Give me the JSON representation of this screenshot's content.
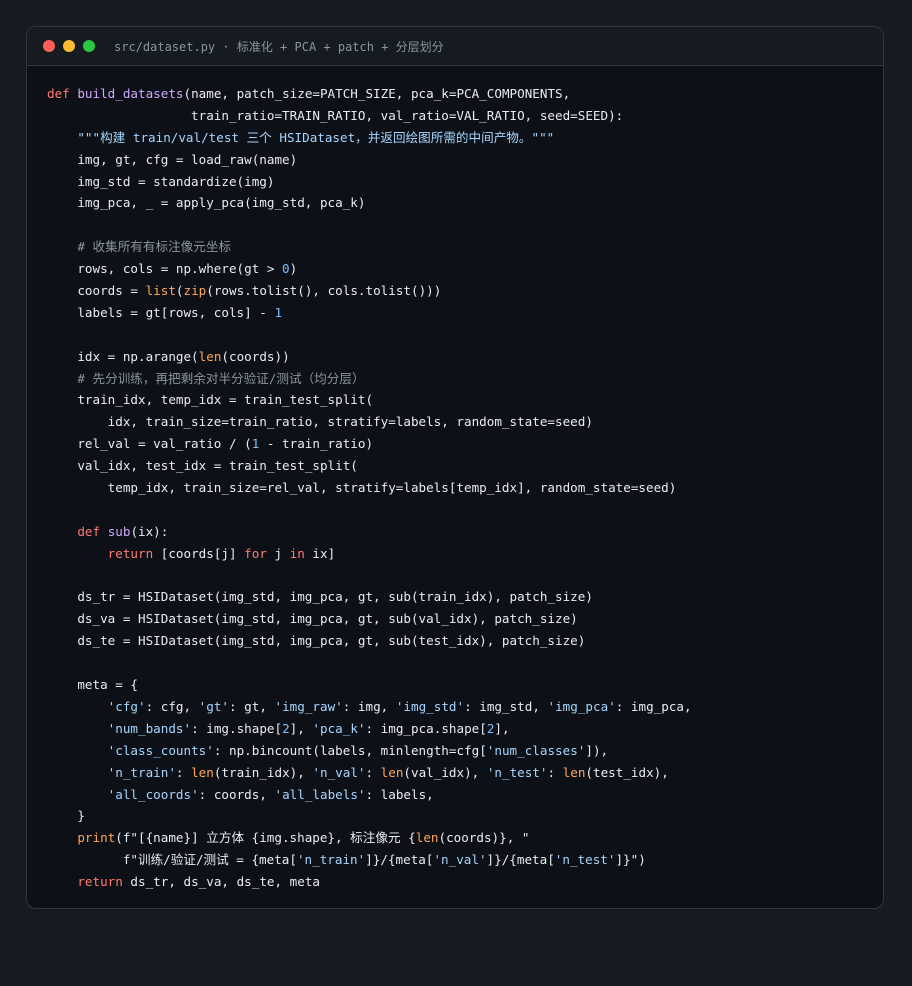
{
  "window": {
    "title": "src/dataset.py · 标准化 + PCA + patch + 分层划分"
  },
  "colors": {
    "keyword": "#ff7b72",
    "function": "#d2a8ff",
    "string": "#a5d6ff",
    "number": "#79c0ff",
    "comment": "#8b949e",
    "builtin": "#ffa657",
    "text": "#e6edf3"
  },
  "code": {
    "lines": [
      [
        [
          "kw",
          "def"
        ],
        [
          "tx",
          " "
        ],
        [
          "fn",
          "build_datasets"
        ],
        [
          "tx",
          "(name, patch_size=PATCH_SIZE, pca_k=PCA_COMPONENTS,"
        ]
      ],
      [
        [
          "tx",
          "                   train_ratio=TRAIN_RATIO, val_ratio=VAL_RATIO, seed=SEED):"
        ]
      ],
      [
        [
          "tx",
          "    "
        ],
        [
          "str",
          "\"\"\"构建 train/val/test 三个 HSIDataset，并返回绘图所需的中间产物。\"\"\""
        ]
      ],
      [
        [
          "tx",
          "    img, gt, cfg = load_raw(name)"
        ]
      ],
      [
        [
          "tx",
          "    img_std = standardize(img)"
        ]
      ],
      [
        [
          "tx",
          "    img_pca, _ = apply_pca(img_std, pca_k)"
        ]
      ],
      [
        [
          "tx",
          ""
        ]
      ],
      [
        [
          "tx",
          "    "
        ],
        [
          "cm",
          "# 收集所有有标注像元坐标"
        ]
      ],
      [
        [
          "tx",
          "    rows, cols = np.where(gt > "
        ],
        [
          "num",
          "0"
        ],
        [
          "tx",
          ")"
        ]
      ],
      [
        [
          "tx",
          "    coords = "
        ],
        [
          "bi",
          "list"
        ],
        [
          "tx",
          "("
        ],
        [
          "bi",
          "zip"
        ],
        [
          "tx",
          "(rows.tolist(), cols.tolist()))"
        ]
      ],
      [
        [
          "tx",
          "    labels = gt[rows, cols] - "
        ],
        [
          "num",
          "1"
        ]
      ],
      [
        [
          "tx",
          ""
        ]
      ],
      [
        [
          "tx",
          "    idx = np.arange("
        ],
        [
          "bi",
          "len"
        ],
        [
          "tx",
          "(coords))"
        ]
      ],
      [
        [
          "tx",
          "    "
        ],
        [
          "cm",
          "# 先分训练，再把剩余对半分验证/测试（均分层）"
        ]
      ],
      [
        [
          "tx",
          "    train_idx, temp_idx = train_test_split("
        ]
      ],
      [
        [
          "tx",
          "        idx, train_size=train_ratio, stratify=labels, random_state=seed)"
        ]
      ],
      [
        [
          "tx",
          "    rel_val = val_ratio / ("
        ],
        [
          "num",
          "1"
        ],
        [
          "tx",
          " - train_ratio)"
        ]
      ],
      [
        [
          "tx",
          "    val_idx, test_idx = train_test_split("
        ]
      ],
      [
        [
          "tx",
          "        temp_idx, train_size=rel_val, stratify=labels[temp_idx], random_state=seed)"
        ]
      ],
      [
        [
          "tx",
          ""
        ]
      ],
      [
        [
          "tx",
          "    "
        ],
        [
          "kw",
          "def"
        ],
        [
          "tx",
          " "
        ],
        [
          "fn",
          "sub"
        ],
        [
          "tx",
          "(ix):"
        ]
      ],
      [
        [
          "tx",
          "        "
        ],
        [
          "kw",
          "return"
        ],
        [
          "tx",
          " [coords[j] "
        ],
        [
          "kw",
          "for"
        ],
        [
          "tx",
          " j "
        ],
        [
          "kw",
          "in"
        ],
        [
          "tx",
          " ix]"
        ]
      ],
      [
        [
          "tx",
          ""
        ]
      ],
      [
        [
          "tx",
          "    ds_tr = HSIDataset(img_std, img_pca, gt, sub(train_idx), patch_size)"
        ]
      ],
      [
        [
          "tx",
          "    ds_va = HSIDataset(img_std, img_pca, gt, sub(val_idx), patch_size)"
        ]
      ],
      [
        [
          "tx",
          "    ds_te = HSIDataset(img_std, img_pca, gt, sub(test_idx), patch_size)"
        ]
      ],
      [
        [
          "tx",
          ""
        ]
      ],
      [
        [
          "tx",
          "    meta = {"
        ]
      ],
      [
        [
          "tx",
          "        "
        ],
        [
          "str",
          "'cfg'"
        ],
        [
          "tx",
          ": cfg, "
        ],
        [
          "str",
          "'gt'"
        ],
        [
          "tx",
          ": gt, "
        ],
        [
          "str",
          "'img_raw'"
        ],
        [
          "tx",
          ": img, "
        ],
        [
          "str",
          "'img_std'"
        ],
        [
          "tx",
          ": img_std, "
        ],
        [
          "str",
          "'img_pca'"
        ],
        [
          "tx",
          ": img_pca,"
        ]
      ],
      [
        [
          "tx",
          "        "
        ],
        [
          "str",
          "'num_bands'"
        ],
        [
          "tx",
          ": img.shape["
        ],
        [
          "num",
          "2"
        ],
        [
          "tx",
          "], "
        ],
        [
          "str",
          "'pca_k'"
        ],
        [
          "tx",
          ": img_pca.shape["
        ],
        [
          "num",
          "2"
        ],
        [
          "tx",
          "],"
        ]
      ],
      [
        [
          "tx",
          "        "
        ],
        [
          "str",
          "'class_counts'"
        ],
        [
          "tx",
          ": np.bincount(labels, minlength=cfg["
        ],
        [
          "str",
          "'num_classes'"
        ],
        [
          "tx",
          "]),"
        ]
      ],
      [
        [
          "tx",
          "        "
        ],
        [
          "str",
          "'n_train'"
        ],
        [
          "tx",
          ": "
        ],
        [
          "bi",
          "len"
        ],
        [
          "tx",
          "(train_idx), "
        ],
        [
          "str",
          "'n_val'"
        ],
        [
          "tx",
          ": "
        ],
        [
          "bi",
          "len"
        ],
        [
          "tx",
          "(val_idx), "
        ],
        [
          "str",
          "'n_test'"
        ],
        [
          "tx",
          ": "
        ],
        [
          "bi",
          "len"
        ],
        [
          "tx",
          "(test_idx),"
        ]
      ],
      [
        [
          "tx",
          "        "
        ],
        [
          "str",
          "'all_coords'"
        ],
        [
          "tx",
          ": coords, "
        ],
        [
          "str",
          "'all_labels'"
        ],
        [
          "tx",
          ": labels,"
        ]
      ],
      [
        [
          "tx",
          "    }"
        ]
      ],
      [
        [
          "tx",
          "    "
        ],
        [
          "bi",
          "print"
        ],
        [
          "tx",
          "(f\"[{name}] 立方体 {img.shape}, 标注像元 {"
        ],
        [
          "bi",
          "len"
        ],
        [
          "tx",
          "(coords)}, \""
        ]
      ],
      [
        [
          "tx",
          "          f\"训练/验证/测试 = {meta["
        ],
        [
          "str",
          "'n_train'"
        ],
        [
          "tx",
          "]}/{meta["
        ],
        [
          "str",
          "'n_val'"
        ],
        [
          "tx",
          "]}/{meta["
        ],
        [
          "str",
          "'n_test'"
        ],
        [
          "tx",
          "]}\")"
        ]
      ],
      [
        [
          "tx",
          "    "
        ],
        [
          "kw",
          "return"
        ],
        [
          "tx",
          " ds_tr, ds_va, ds_te, meta"
        ]
      ]
    ]
  }
}
